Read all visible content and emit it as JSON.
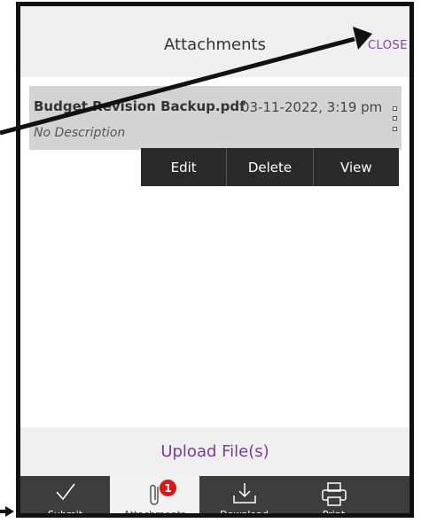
{
  "header": {
    "title": "Attachments",
    "close_label": "CLOSE"
  },
  "attachment": {
    "file_name": "Budget Revision Backup.pdf",
    "date": "03-11-2022, 3:19 pm",
    "description": "No Description"
  },
  "menu": {
    "items": [
      "Edit",
      "Delete",
      "View"
    ]
  },
  "upload": {
    "label": "Upload File(s)"
  },
  "tabbar": {
    "tabs": [
      {
        "label": "Submit",
        "icon": "checkmark-icon"
      },
      {
        "label": "Attachments",
        "icon": "paperclip-icon",
        "badge": "1",
        "active": true
      },
      {
        "label": "Download",
        "icon": "download-icon"
      },
      {
        "label": "Print",
        "icon": "printer-icon"
      }
    ]
  },
  "colors": {
    "accent_purple": "#7a3d95",
    "tabbar_bg": "#3d3d3d",
    "badge_red": "#e01414"
  }
}
